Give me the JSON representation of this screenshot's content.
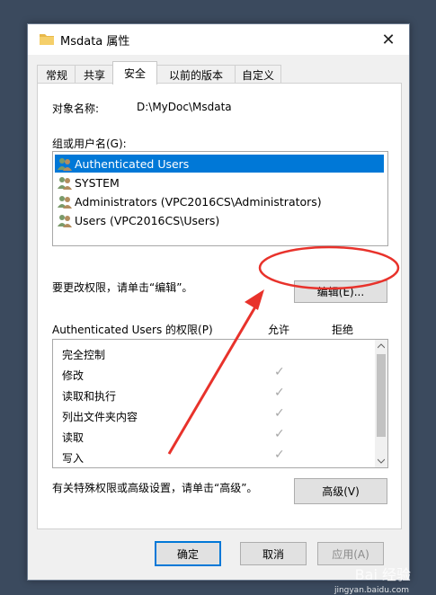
{
  "window": {
    "title": "Msdata 属性",
    "close_glyph": "✕"
  },
  "tabs": [
    {
      "label": "常规"
    },
    {
      "label": "共享"
    },
    {
      "label": "安全",
      "active": true
    },
    {
      "label": "以前的版本"
    },
    {
      "label": "自定义"
    }
  ],
  "security": {
    "object_name_label": "对象名称:",
    "object_name_value": "D:\\MyDoc\\Msdata",
    "group_label": "组或用户名(G):",
    "users": [
      {
        "name": "Authenticated Users",
        "selected": true
      },
      {
        "name": "SYSTEM"
      },
      {
        "name": "Administrators (VPC2016CS\\Administrators)"
      },
      {
        "name": "Users (VPC2016CS\\Users)"
      }
    ],
    "edit_hint": "要更改权限，请单击“编辑”。",
    "edit_button": "编辑(E)...",
    "permissions_label": "Authenticated Users 的权限(P)",
    "allow_header": "允许",
    "deny_header": "拒绝",
    "permissions": [
      {
        "name": "完全控制",
        "allow": false
      },
      {
        "name": "修改",
        "allow": true
      },
      {
        "name": "读取和执行",
        "allow": true
      },
      {
        "name": "列出文件夹内容",
        "allow": true
      },
      {
        "name": "读取",
        "allow": true
      },
      {
        "name": "写入",
        "allow": true
      }
    ],
    "check_glyph": "✓",
    "advanced_hint": "有关特殊权限或高级设置，请单击“高级”。",
    "advanced_button": "高级(V)"
  },
  "footer": {
    "ok_button": "确定",
    "cancel_button": "取消",
    "apply_button": "应用(A)"
  },
  "watermark": {
    "text": "Bai 经验",
    "url": "jingyan.baidu.com"
  },
  "colors": {
    "selection": "#0078d7",
    "annotation": "#e8322b"
  }
}
